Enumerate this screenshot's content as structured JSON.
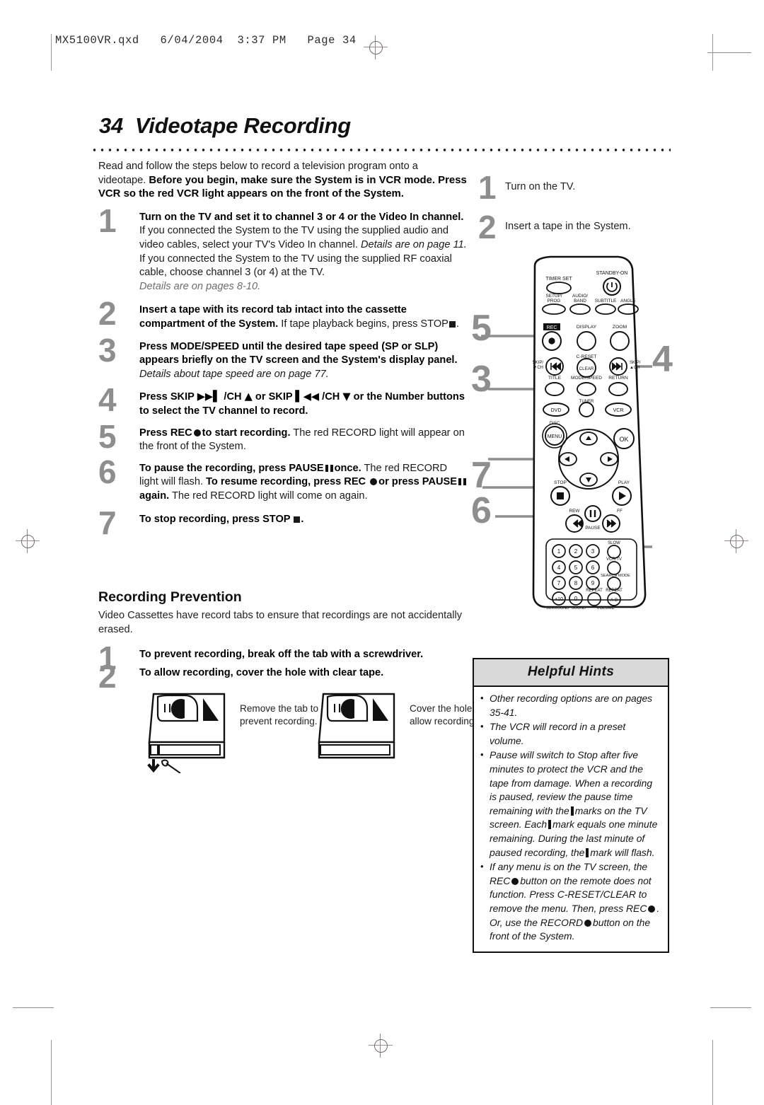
{
  "file_header": "MX5100VR.qxd   6/04/2004  3:37 PM   Page 34",
  "page": {
    "number": "34",
    "title": "Videotape Recording"
  },
  "intro": {
    "plain1": "Read and follow the steps below to record a television program onto a videotape. ",
    "bold1": "Before you begin, make sure the System is in VCR mode. Press VCR so the red VCR light appears on the front of the System."
  },
  "steps": [
    {
      "num": "1",
      "bold": "Turn on the TV and set it to channel 3 or 4 or the Video In channel.",
      "plain": " If you connected the System to the TV using the supplied audio and video cables, select your TV's Video In channel. ",
      "italic": "Details are on page 11.",
      "plain2": "If you connected the System to the TV using the supplied RF coaxial cable, choose channel 3 (or 4) at the TV.",
      "italic2": "Details are on pages 8-10."
    },
    {
      "num": "2",
      "bold": "Insert a tape with its record tab intact into the cassette compartment of the System.",
      "plain": " If tape playback begins, press STOP"
    },
    {
      "num": "3",
      "bold": "Press MODE/SPEED until the desired tape speed (SP or SLP) appears briefly on the TV screen and the System's display panel.",
      "italic": "Details about tape speed are on page 77."
    },
    {
      "num": "4",
      "bold_a": "Press SKIP",
      "bold_b": "/CH",
      "bold_c": "or SKIP",
      "bold_d": "/CH",
      "bold_e": "or the Number buttons to select the TV channel to record."
    },
    {
      "num": "5",
      "bold_a": "Press REC",
      "bold_b": "to start recording.",
      "plain": " The red RECORD light will appear on the front of the System."
    },
    {
      "num": "6",
      "bold_a": "To pause the recording, press PAUSE",
      "bold_b": "once.",
      "plain_a": " The red RECORD light will flash. ",
      "bold_c": "To resume recording, press REC",
      "bold_d": "or press PAUSE",
      "bold_e": "again.",
      "plain_b": " The red RECORD light will come on again."
    },
    {
      "num": "7",
      "bold_a": "To stop recording, press STOP"
    }
  ],
  "prevention": {
    "heading": "Recording Prevention",
    "body": "Video Cassettes have record tabs to ensure that recordings are not accidentally erased.",
    "steps": [
      {
        "num": "1",
        "bold": "To prevent recording, break off the tab with a screwdriver."
      },
      {
        "num": "2",
        "bold": "To allow recording, cover the hole with clear tape."
      }
    ],
    "figures": [
      {
        "caption": "Remove the tab to prevent recording."
      },
      {
        "caption": "Cover the hole to allow recording."
      }
    ]
  },
  "right_steps": [
    {
      "num": "1",
      "text": "Turn on the TV."
    },
    {
      "num": "2",
      "text": "Insert a tape in the System."
    }
  ],
  "remote": {
    "callouts": [
      "5",
      "3",
      "7",
      "6",
      "4"
    ],
    "buttons": {
      "timer_set": "TIMER SET",
      "standby_on": "STANDBY-ON",
      "setup_prog": "SETUP/ PROG",
      "audio_band": "AUDIO/ BAND",
      "subtitle": "SUBTITLE",
      "angle": "ANGLE",
      "rec": "REC",
      "display": "DISPLAY",
      "zoom": "ZOOM",
      "skip_down": "SKIP/ ▼CH",
      "c_reset": "C-RESET",
      "clear": "CLEAR",
      "skip_up": "SKIP/ ▲CH",
      "title": "TITLE",
      "mode_speed": "MODE/SPEED",
      "return": "RETURN",
      "dvd": "DVD",
      "tuner": "TUNER",
      "vcr": "VCR",
      "disc": "DISC",
      "menu": "MENU",
      "ok": "OK",
      "stop": "STOP",
      "play": "PLAY",
      "rew": "REW",
      "pause": "PAUSE",
      "ff": "FF",
      "slow": "SLOW",
      "vcr_tv": "VCR/TV",
      "search_mode": "SEARCH MODE",
      "repeat": "REPEAT",
      "repeat_ab": "REPEAT A-B",
      "surround": "SURROUND",
      "sound": "SOUND",
      "volume": "VOLUME",
      "vol_minus": "−",
      "vol_plus": "+",
      "num_1": "1",
      "num_2": "2",
      "num_3": "3",
      "num_4": "4",
      "num_5": "5",
      "num_6": "6",
      "num_7": "7",
      "num_8": "8",
      "num_9": "9",
      "num_plus10": "+10",
      "num_0": "0"
    }
  },
  "hints": {
    "title": "Helpful Hints",
    "items": [
      "Other recording options are on pages 35-41.",
      "The VCR will record in a preset volume.",
      "Pause will switch to Stop after five minutes to protect the VCR and the tape from damage. When a recording is paused, review the pause time remaining with the",
      "If any menu is on the TV screen, the REC"
    ],
    "item3_b": "marks on the TV screen. Each",
    "item3_c": "mark equals one minute remaining. During the last minute of paused recording, the",
    "item3_d": "mark will flash.",
    "item4_b": "button on the remote does not function. Press C-RESET/CLEAR to remove the menu. Then, press REC",
    "item4_c": ". Or, use the RECORD",
    "item4_d": "button on the front of the System."
  },
  "colors": {
    "step_number": "#8e8e8e",
    "hints_header_bg": "#d9d9d9",
    "ink": "#111111"
  }
}
